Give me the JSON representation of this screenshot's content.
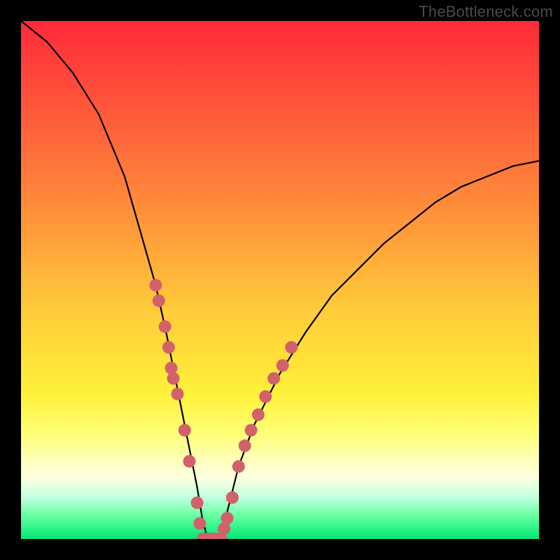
{
  "watermark": "TheBottleneck.com",
  "chart_data": {
    "type": "line",
    "title": "",
    "xlabel": "",
    "ylabel": "",
    "xlim": [
      0,
      100
    ],
    "ylim": [
      0,
      100
    ],
    "series": [
      {
        "name": "bottleneck-curve",
        "x": [
          0,
          5,
          10,
          15,
          20,
          22,
          24,
          26,
          28,
          30,
          32,
          34,
          35,
          36,
          37,
          38,
          39,
          40,
          42,
          45,
          50,
          55,
          60,
          65,
          70,
          75,
          80,
          85,
          90,
          95,
          100
        ],
        "values": [
          100,
          96,
          90,
          82,
          70,
          63,
          56,
          49,
          40,
          30,
          20,
          10,
          4,
          0,
          0,
          0,
          2,
          6,
          14,
          22,
          32,
          40,
          47,
          52,
          57,
          61,
          65,
          68,
          70,
          72,
          73
        ]
      }
    ],
    "markers": {
      "name": "highlight-dots",
      "color": "#d2616b",
      "points": [
        {
          "x": 26.0,
          "y": 49
        },
        {
          "x": 26.6,
          "y": 46
        },
        {
          "x": 27.8,
          "y": 41
        },
        {
          "x": 28.5,
          "y": 37
        },
        {
          "x": 29.0,
          "y": 33
        },
        {
          "x": 29.4,
          "y": 31
        },
        {
          "x": 30.2,
          "y": 28
        },
        {
          "x": 31.6,
          "y": 21
        },
        {
          "x": 32.5,
          "y": 15
        },
        {
          "x": 34.0,
          "y": 7
        },
        {
          "x": 34.5,
          "y": 3
        },
        {
          "x": 35.1,
          "y": 0
        },
        {
          "x": 35.6,
          "y": 0
        },
        {
          "x": 36.2,
          "y": 0
        },
        {
          "x": 36.8,
          "y": 0
        },
        {
          "x": 37.4,
          "y": 0
        },
        {
          "x": 38.0,
          "y": 0
        },
        {
          "x": 38.6,
          "y": 0
        },
        {
          "x": 39.2,
          "y": 2
        },
        {
          "x": 39.8,
          "y": 4
        },
        {
          "x": 40.8,
          "y": 8
        },
        {
          "x": 42.0,
          "y": 14
        },
        {
          "x": 43.2,
          "y": 18
        },
        {
          "x": 44.4,
          "y": 21
        },
        {
          "x": 45.8,
          "y": 24
        },
        {
          "x": 47.2,
          "y": 27.5
        },
        {
          "x": 48.8,
          "y": 31
        },
        {
          "x": 50.5,
          "y": 33.5
        },
        {
          "x": 52.2,
          "y": 37
        }
      ]
    }
  }
}
